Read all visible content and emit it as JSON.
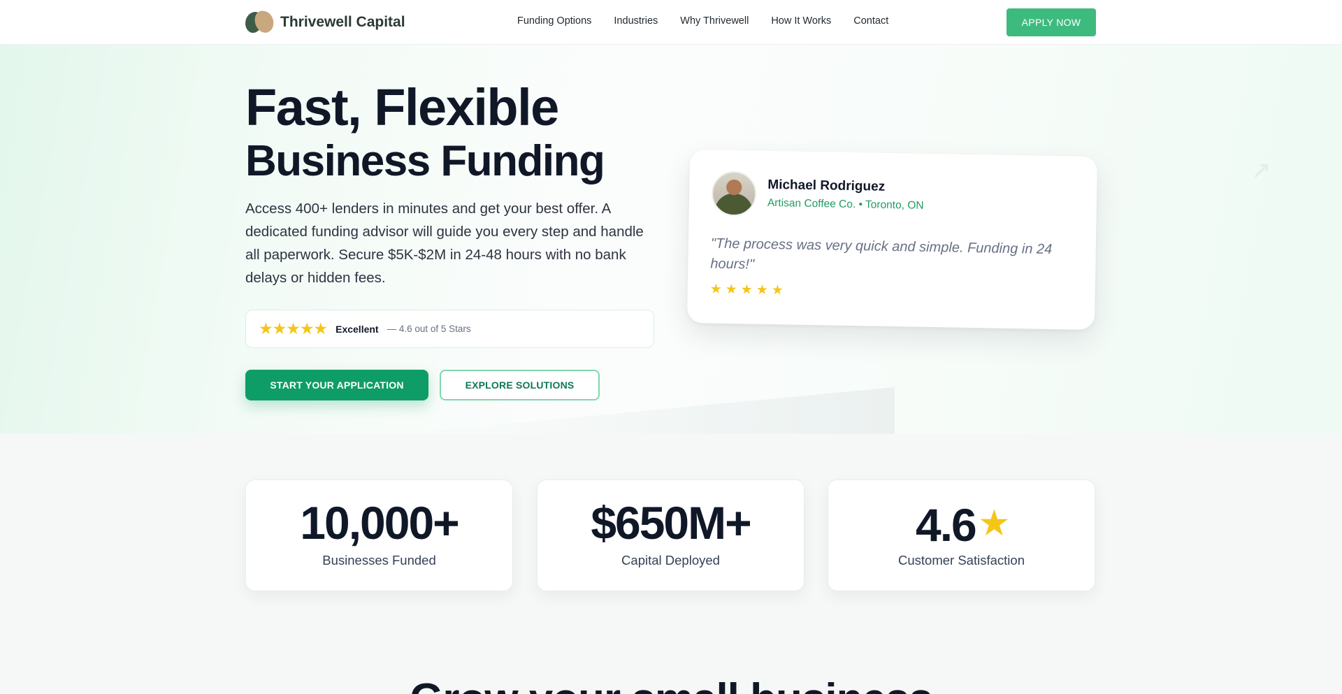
{
  "nav": {
    "brand": "Thrivewell Capital",
    "links": [
      "Funding Options",
      "Industries",
      "Why Thrivewell",
      "How It Works",
      "Contact"
    ],
    "cta": "APPLY NOW"
  },
  "hero": {
    "title_line1": "Fast, Flexible",
    "title_line2": "Business Funding",
    "description": "Access 400+ lenders in minutes and get your best offer. A dedicated funding advisor will guide you every step and handle all paperwork. Secure $5K-$2M in 24-48 hours with no bank delays or hidden fees.",
    "rating": {
      "stars": "★★★★★",
      "word": "Excellent",
      "sub": "— 4.6 out of 5 Stars"
    },
    "primary_cta": "START YOUR APPLICATION",
    "secondary_cta": "EXPLORE SOLUTIONS"
  },
  "testimonial": {
    "name": "Michael Rodriguez",
    "company": "Artisan Coffee Co. • Toronto, ON",
    "quote": "\"The process was very quick and simple. Funding in 24 hours!\"",
    "stars": "★★★★★"
  },
  "stats": [
    {
      "value": "10,000+",
      "label": "Businesses Funded"
    },
    {
      "value": "$650M+",
      "label": "Capital Deployed"
    },
    {
      "value": "4.6",
      "label": "Customer Satisfaction",
      "icon": "star-icon"
    }
  ],
  "next_section": {
    "heading": "Grow your small business"
  },
  "colors": {
    "brand_green": "#0f9d67",
    "apply_green": "#3dbb7f",
    "star_gold": "#f5c518",
    "text_dark": "#101828"
  }
}
